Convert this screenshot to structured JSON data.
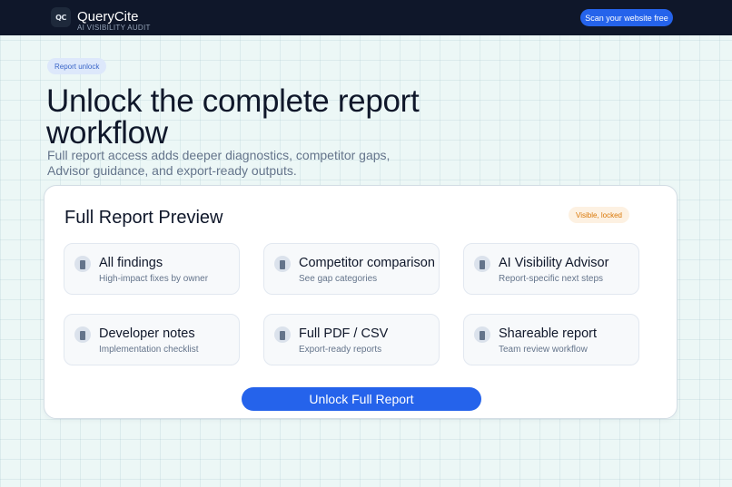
{
  "header": {
    "logo_text": "QC",
    "brand_name": "QueryCite",
    "brand_subtitle": "AI VISIBILITY AUDIT",
    "cta_label": "Scan your website free"
  },
  "hero": {
    "eyebrow": "Report unlock",
    "title": "Unlock the complete report workflow",
    "description": "Full report access adds deeper diagnostics, competitor gaps, Advisor guidance, and export-ready outputs."
  },
  "preview": {
    "title": "Full Report Preview",
    "status_badge": "Visible, locked",
    "features": [
      {
        "title": "All findings",
        "subtitle": "High-impact fixes by owner",
        "icon": "document-icon"
      },
      {
        "title": "Competitor comparison",
        "subtitle": "See gap categories",
        "icon": "document-icon"
      },
      {
        "title": "AI Visibility Advisor",
        "subtitle": "Report-specific next steps",
        "icon": "document-icon"
      },
      {
        "title": "Developer notes",
        "subtitle": "Implementation checklist",
        "icon": "document-icon"
      },
      {
        "title": "Full PDF / CSV",
        "subtitle": "Export-ready reports",
        "icon": "document-icon"
      },
      {
        "title": "Shareable report",
        "subtitle": "Team review workflow",
        "icon": "document-icon"
      }
    ],
    "unlock_label": "Unlock Full Report"
  },
  "colors": {
    "accent": "#2563eb",
    "header_bg": "#0f172a",
    "page_bg": "#ecf7f6",
    "badge_text": "#d97706"
  }
}
